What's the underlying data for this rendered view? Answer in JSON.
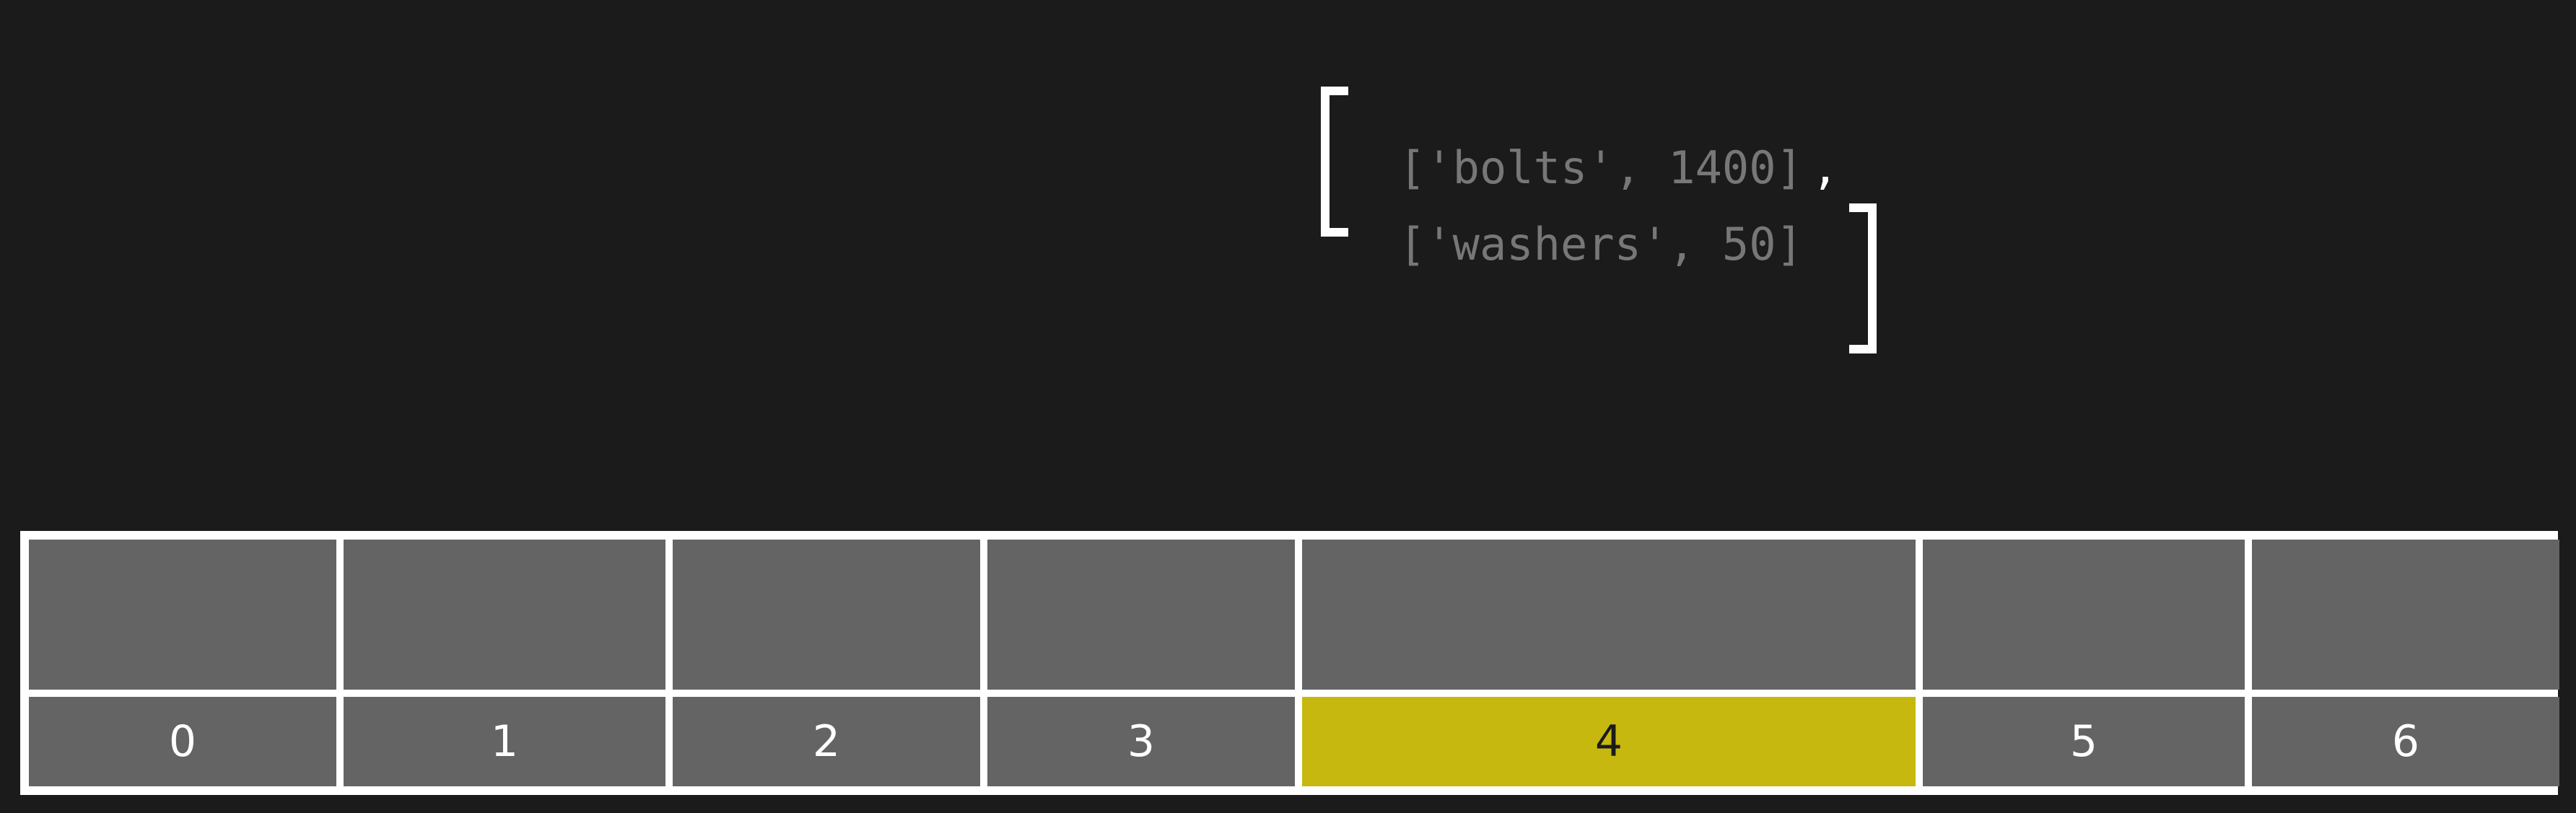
{
  "literal": {
    "open_bracket": "[",
    "close_bracket": "]",
    "lines": [
      "['bolts', 1400]",
      "['washers', 50]"
    ],
    "separator": ","
  },
  "array": {
    "indices": [
      "0",
      "1",
      "2",
      "3",
      "4",
      "5",
      "6"
    ],
    "highlighted_index": "4",
    "colors": {
      "background": "#1b1b1b",
      "slot": "#646464",
      "border": "#ffffff",
      "highlight": "#c7b80f"
    }
  }
}
